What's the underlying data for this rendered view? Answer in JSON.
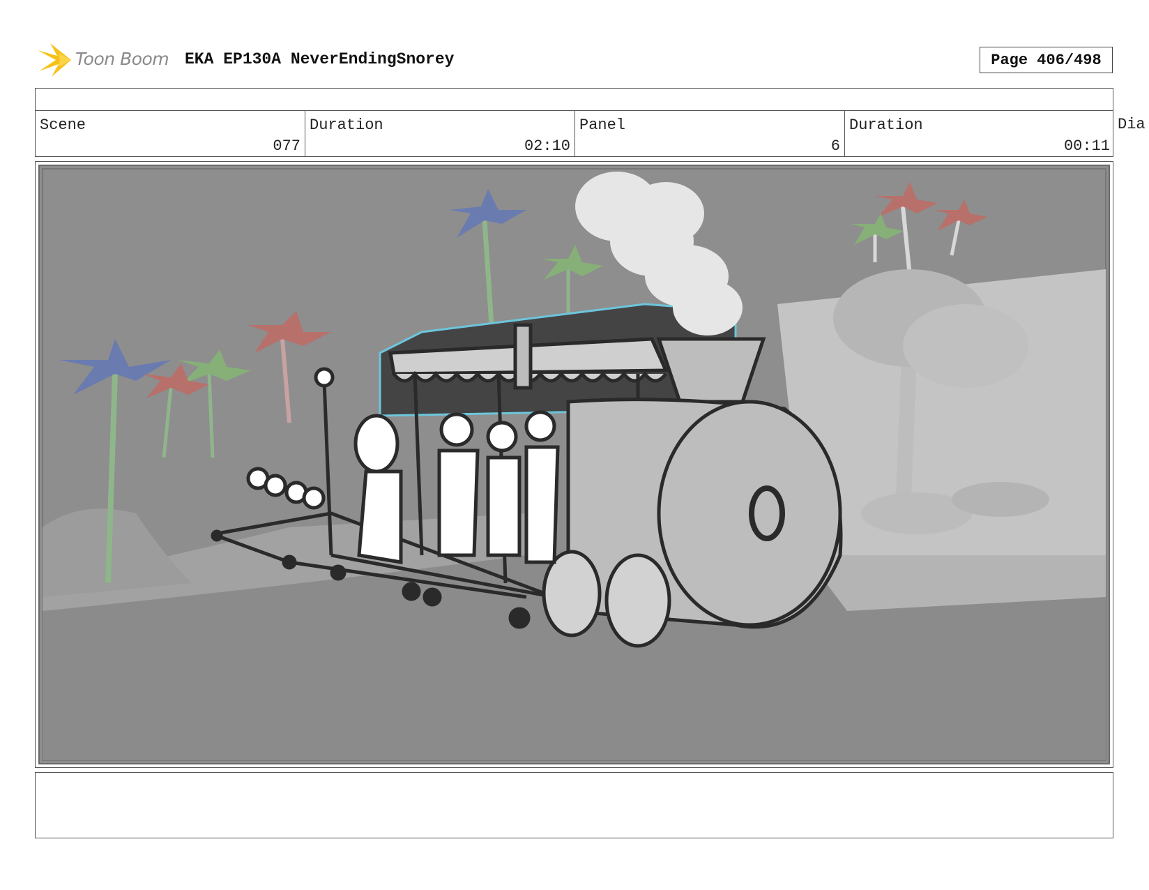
{
  "header": {
    "logo_text": "Toon Boom",
    "document_title": "EKA EP130A NeverEndingSnorey",
    "page_label": "Page 406/498"
  },
  "info": {
    "scene_label": "Scene",
    "scene_value": "077",
    "scene_duration_label": "Duration",
    "scene_duration_value": "02:10",
    "panel_label": "Panel",
    "panel_value": "6",
    "panel_duration_label": "Duration",
    "panel_duration_value": "00:11",
    "overflow_label": "Dia"
  },
  "colors": {
    "logo_star": "#f6c21a",
    "panel_background": "#8e8e8e",
    "palm_red": "#b8706a",
    "palm_blue": "#6a7bb0",
    "palm_green": "#86b078",
    "set_outline": "#6cc6dc"
  }
}
